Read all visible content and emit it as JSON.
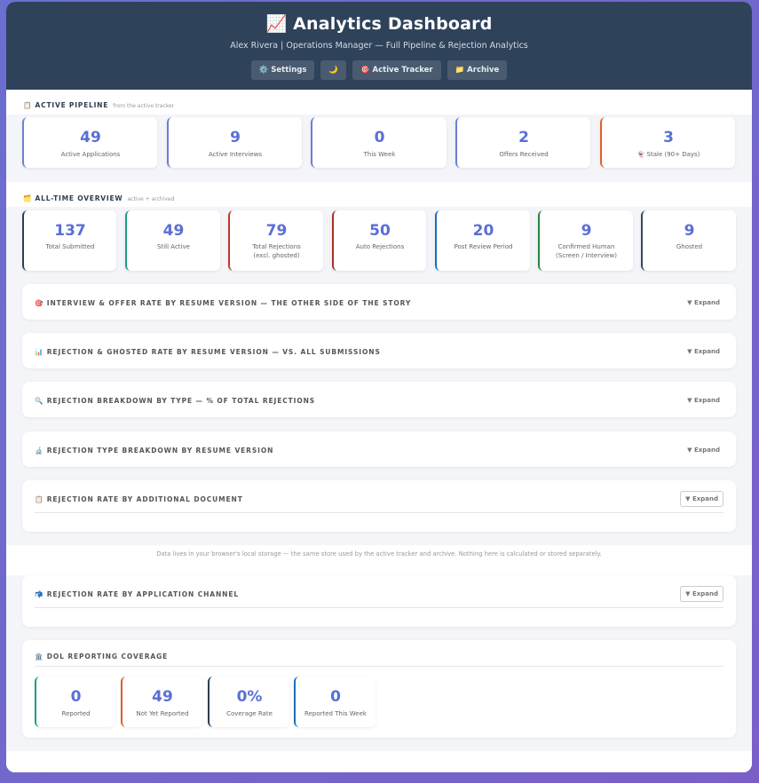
{
  "header": {
    "title": "📈 Analytics Dashboard",
    "subtitle": "Alex Rivera | Operations Manager — Full Pipeline & Rejection Analytics",
    "buttons": {
      "settings": "⚙️ Settings",
      "theme": "🌙",
      "active_tracker": "🎯 Active Tracker",
      "archive": "📁 Archive"
    }
  },
  "active_pipeline": {
    "label": "📋 Active Pipeline",
    "sublabel": "from the active tracker",
    "stats": [
      {
        "value": "49",
        "label": "Active Applications",
        "color": "#6b7fd7"
      },
      {
        "value": "9",
        "label": "Active Interviews",
        "color": "#6b7fd7"
      },
      {
        "value": "0",
        "label": "This Week",
        "color": "#6b7fd7"
      },
      {
        "value": "2",
        "label": "Offers Received",
        "color": "#6b7fd7"
      },
      {
        "value": "3",
        "label": "👻 Stale (90+ Days)",
        "color": "#e0602a"
      }
    ]
  },
  "all_time": {
    "label": "🗂️ All-Time Overview",
    "sublabel": "active + archived",
    "stats": [
      {
        "value": "137",
        "label": "Total Submitted",
        "label2": "",
        "color": "#2c3e50"
      },
      {
        "value": "49",
        "label": "Still Active",
        "label2": "",
        "color": "#16a085"
      },
      {
        "value": "79",
        "label": "Total Rejections",
        "label2": "(excl. ghosted)",
        "color": "#c0392b"
      },
      {
        "value": "50",
        "label": "Auto Rejections",
        "label2": "",
        "color": "#a93226"
      },
      {
        "value": "20",
        "label": "Post Review Period",
        "label2": "",
        "color": "#1a6fbf"
      },
      {
        "value": "9",
        "label": "Confirmed Human",
        "label2": "(Screen / Interview)",
        "color": "#27863f"
      },
      {
        "value": "9",
        "label": "Ghosted",
        "label2": "",
        "color": "#34495e"
      }
    ]
  },
  "panels": [
    {
      "title": "🎯 Interview & Offer Rate by Resume Version — the other side of the story",
      "expand": "▼ Expand"
    },
    {
      "title": "📊 Rejection & Ghosted Rate by Resume Version — vs. all submissions",
      "expand": "▼ Expand"
    },
    {
      "title": "🔍 Rejection Breakdown by Type — % of Total Rejections",
      "expand": "▼ Expand"
    },
    {
      "title": "🔬 Rejection Type Breakdown by Resume Version",
      "expand": "▼ Expand"
    },
    {
      "title": "📋 Rejection Rate by Additional Document",
      "expand": "▼ Expand"
    }
  ],
  "footnote": "Data lives in your browser's local storage — the same store used by the active tracker and archive. Nothing here is calculated or stored separately.",
  "channel_panel": {
    "title": "📬 Rejection Rate by Application Channel",
    "expand": "▼ Expand"
  },
  "dol": {
    "title": "🏛️ DOL Reporting Coverage",
    "stats": [
      {
        "value": "0",
        "label": "Reported",
        "color": "#16a085"
      },
      {
        "value": "49",
        "label": "Not Yet Reported",
        "color": "#e0602a"
      },
      {
        "value": "0%",
        "label": "Coverage Rate",
        "color": "#2c3e50"
      },
      {
        "value": "0",
        "label": "Reported This Week",
        "color": "#1a6fbf"
      }
    ]
  }
}
